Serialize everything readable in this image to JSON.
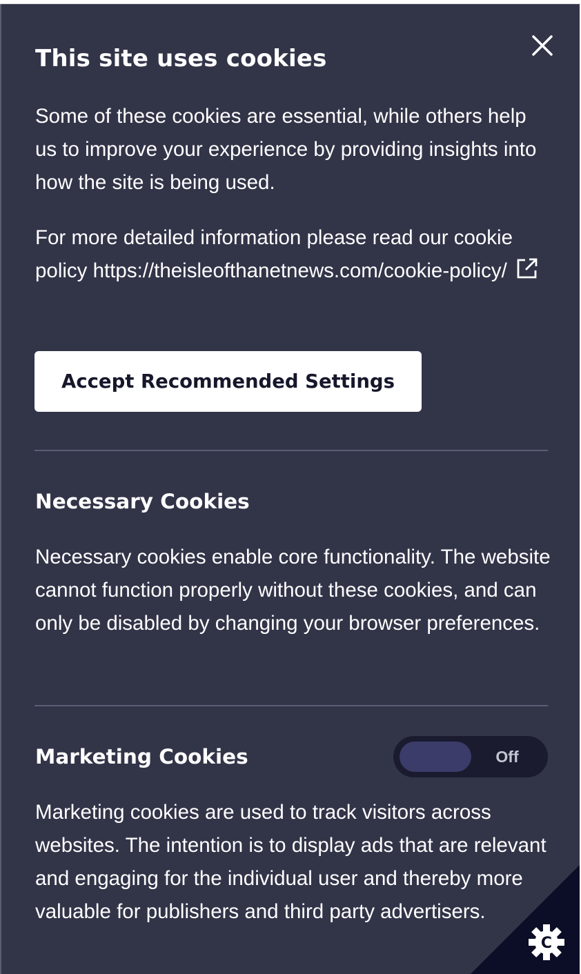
{
  "dialog": {
    "title": "This site uses cookies",
    "intro": "Some of these cookies are essential, while others help us to improve your experience by providing insights into how the site is being used.",
    "more_info_prefix": "For more detailed information please read our cookie policy",
    "policy_link_text": "https://theisleofthanetnews.com/cookie-policy/",
    "accept_button_label": "Accept Recommended Settings",
    "close_icon": "close-icon",
    "external_link_icon": "external-link-icon"
  },
  "sections": {
    "necessary": {
      "heading": "Necessary Cookies",
      "description": "Necessary cookies enable core functionality. The website cannot function properly without these cookies, and can only be disabled by changing your browser preferences."
    },
    "marketing": {
      "heading": "Marketing Cookies",
      "toggle_label": "Off",
      "toggle_on": false,
      "description": "Marketing cookies are used to track visitors across websites. The intention is to display ads that are relevant and engaging for the individual user and thereby more valuable for publishers and third party advertisers."
    }
  },
  "badge": {
    "icon": "cookie-gear-icon",
    "letter": "C"
  },
  "colors": {
    "panel_background": "#323448",
    "text": "#ffffff",
    "button_background": "#ffffff",
    "button_text": "#16172b",
    "toggle_track": "#1a1b2e",
    "toggle_knob": "#3b3c69",
    "badge_background": "#0c0d26"
  }
}
